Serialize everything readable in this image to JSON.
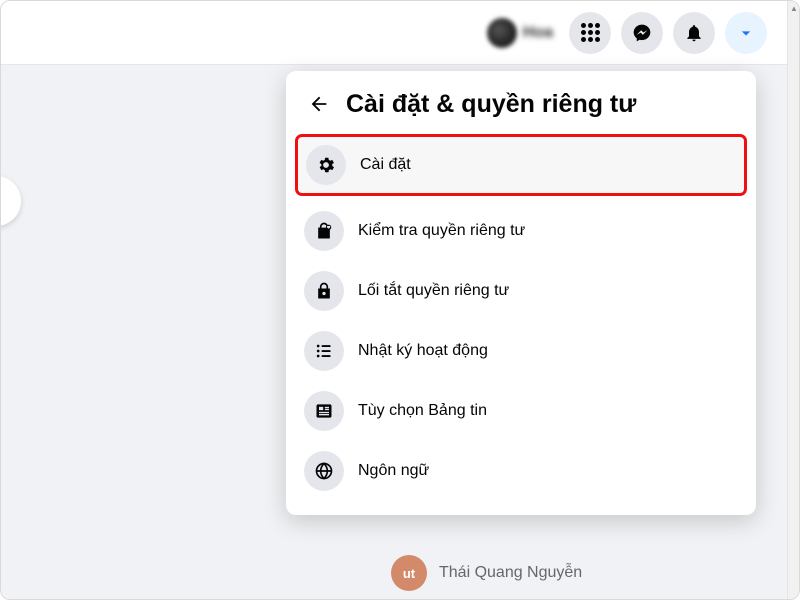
{
  "topbar": {
    "profile_name": "Hoa",
    "icons": {
      "menu": "menu-grid-icon",
      "messenger": "messenger-icon",
      "notifications": "bell-icon",
      "account": "caret-down-icon"
    }
  },
  "menu": {
    "title": "Cài đặt & quyền riêng tư",
    "items": [
      {
        "icon": "gear-icon",
        "label": "Cài đặt",
        "highlight": true
      },
      {
        "icon": "lock-heart-icon",
        "label": "Kiểm tra quyền riêng tư"
      },
      {
        "icon": "lock-icon",
        "label": "Lối tắt quyền riêng tư"
      },
      {
        "icon": "list-icon",
        "label": "Nhật ký hoạt động"
      },
      {
        "icon": "newsfeed-icon",
        "label": "Tùy chọn Bảng tin"
      },
      {
        "icon": "globe-icon",
        "label": "Ngôn ngữ"
      }
    ]
  },
  "background": {
    "contact_name": "Thái Quang Nguyễn",
    "contact_initials": "ut"
  }
}
